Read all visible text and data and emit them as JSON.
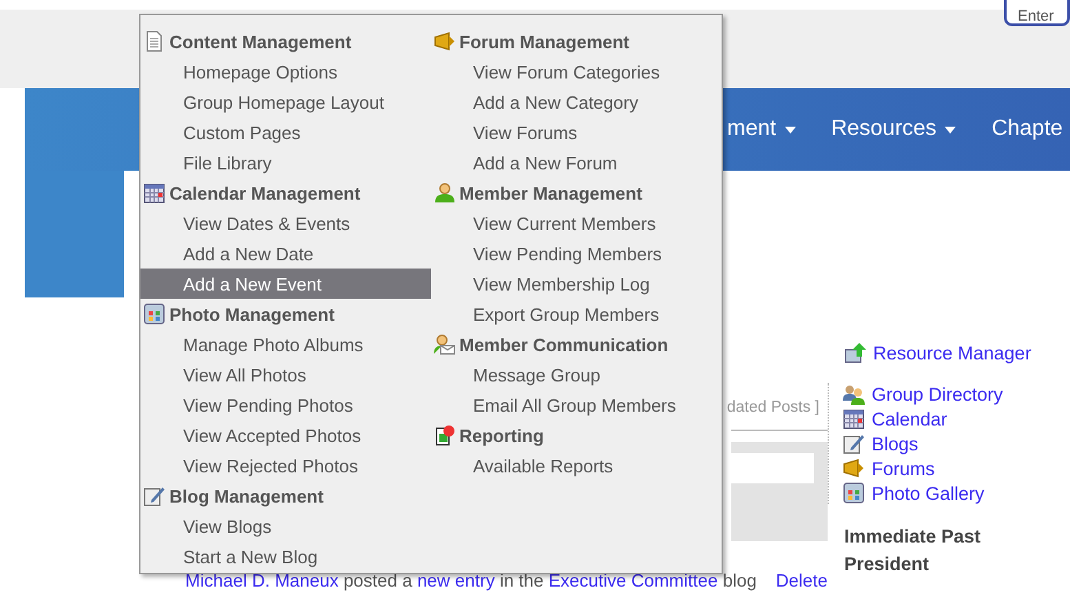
{
  "header": {
    "enter_button": "Enter"
  },
  "nav": [
    {
      "label": "ment",
      "dropdown": true
    },
    {
      "label": "Resources",
      "dropdown": true
    },
    {
      "label": "Chapte",
      "dropdown": false
    }
  ],
  "menu": {
    "columns": [
      [
        {
          "title": "Content Management",
          "kind": "page",
          "items": [
            {
              "label": "Homepage Options",
              "selected": false
            },
            {
              "label": "Group Homepage Layout",
              "selected": false
            },
            {
              "label": "Custom Pages",
              "selected": false
            },
            {
              "label": "File Library",
              "selected": false
            }
          ]
        },
        {
          "title": "Calendar Management",
          "kind": "calendar",
          "items": [
            {
              "label": "View Dates & Events",
              "selected": false
            },
            {
              "label": "Add a New Date",
              "selected": false
            },
            {
              "label": "Add a New Event",
              "selected": true
            }
          ]
        },
        {
          "title": "Photo Management",
          "kind": "photo",
          "items": [
            {
              "label": "Manage Photo Albums",
              "selected": false
            },
            {
              "label": "View All Photos",
              "selected": false
            },
            {
              "label": "View Pending Photos",
              "selected": false
            },
            {
              "label": "View Accepted Photos",
              "selected": false
            },
            {
              "label": "View Rejected Photos",
              "selected": false
            }
          ]
        },
        {
          "title": "Blog Management",
          "kind": "blog",
          "items": [
            {
              "label": "View Blogs",
              "selected": false
            },
            {
              "label": "Start a New Blog",
              "selected": false
            }
          ]
        }
      ],
      [
        {
          "title": "Forum Management",
          "kind": "forum",
          "items": [
            {
              "label": "View Forum Categories",
              "selected": false
            },
            {
              "label": "Add a New Category",
              "selected": false
            },
            {
              "label": "View Forums",
              "selected": false
            },
            {
              "label": "Add a New Forum",
              "selected": false
            }
          ]
        },
        {
          "title": "Member Management",
          "kind": "member",
          "items": [
            {
              "label": "View Current Members",
              "selected": false
            },
            {
              "label": "View Pending Members",
              "selected": false
            },
            {
              "label": "View Membership Log",
              "selected": false
            },
            {
              "label": "Export Group Members",
              "selected": false
            }
          ]
        },
        {
          "title": "Member Communication",
          "kind": "communication",
          "items": [
            {
              "label": "Message Group",
              "selected": false
            },
            {
              "label": "Email All Group Members",
              "selected": false
            }
          ]
        },
        {
          "title": "Reporting",
          "kind": "report",
          "items": [
            {
              "label": "Available Reports",
              "selected": false
            }
          ]
        }
      ]
    ]
  },
  "feed": {
    "tab_text": "dated Posts ]",
    "post": [
      {
        "kind": "link",
        "text": "Michael D. Maneux"
      },
      {
        "kind": "plain",
        "text": "posted a"
      },
      {
        "kind": "link",
        "text": "new entry"
      },
      {
        "kind": "plain",
        "text": "in the"
      },
      {
        "kind": "link",
        "text": "Executive Committee"
      },
      {
        "kind": "plain",
        "text": "blog"
      }
    ],
    "delete": "Delete"
  },
  "sidebar": {
    "resource_manager": "Resource Manager",
    "links": [
      {
        "label": "Group Directory",
        "kind": "directory"
      },
      {
        "label": "Calendar",
        "kind": "calendar"
      },
      {
        "label": "Blogs",
        "kind": "blog"
      },
      {
        "label": "Forums",
        "kind": "forum"
      },
      {
        "label": "Photo Gallery",
        "kind": "photo"
      }
    ],
    "heading": "Immediate Past President"
  }
}
